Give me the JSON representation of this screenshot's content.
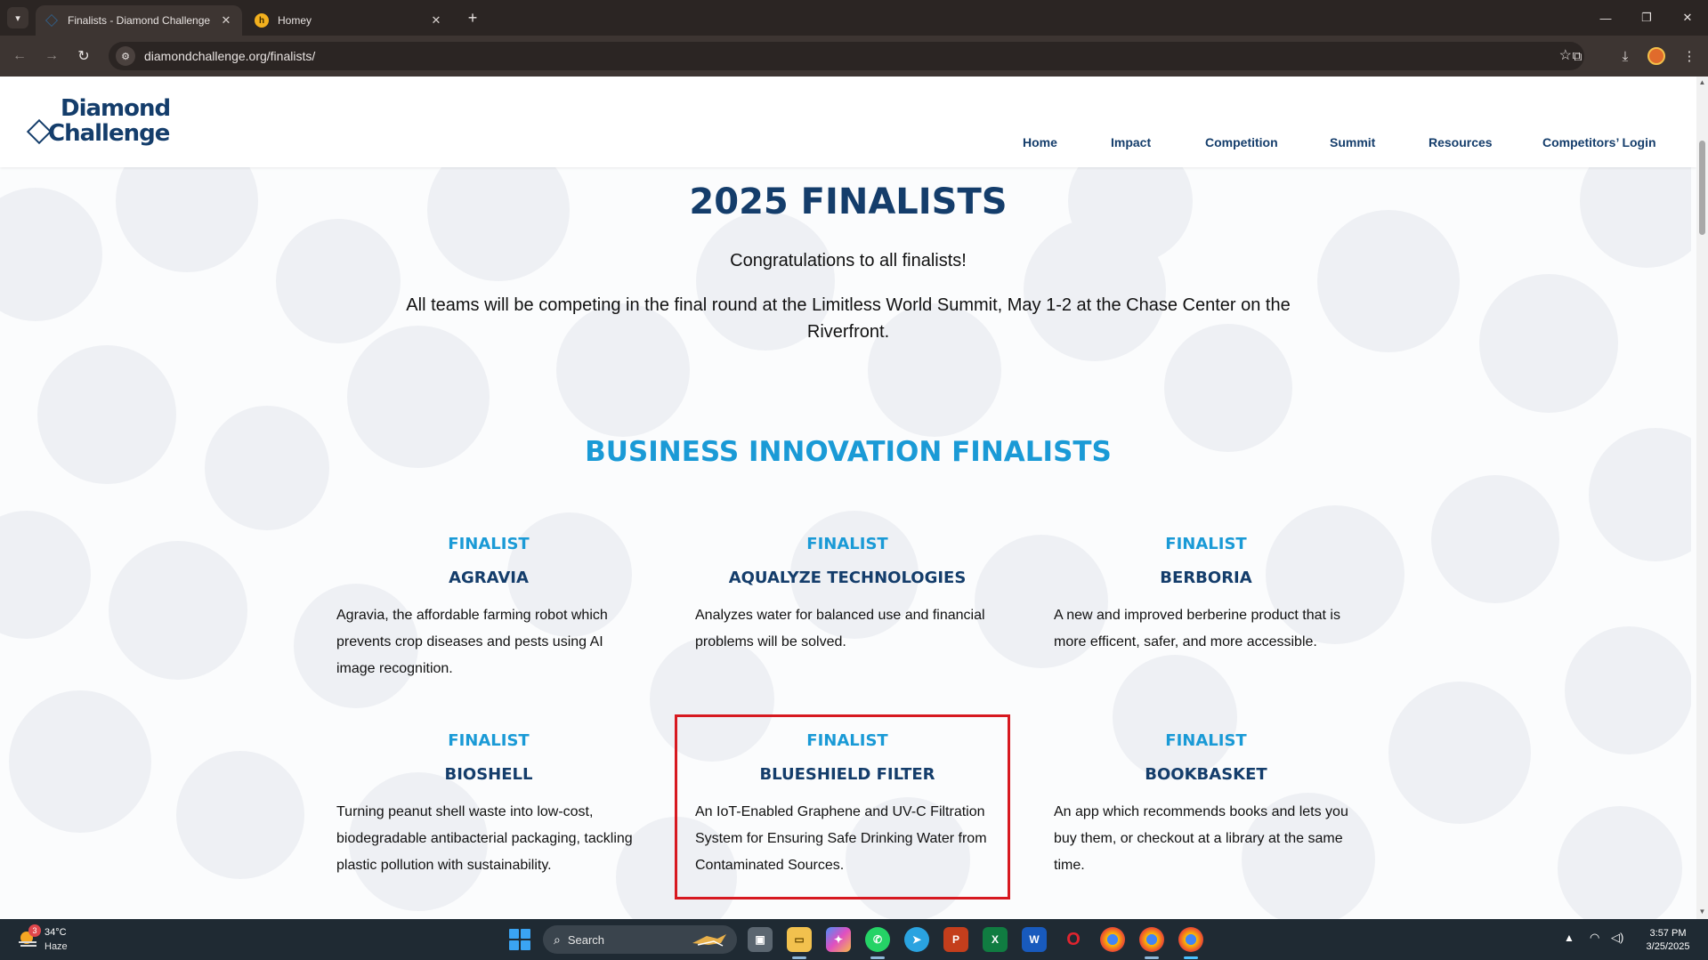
{
  "browser": {
    "tabs": [
      {
        "title": "Finalists - Diamond Challenge",
        "active": true
      },
      {
        "title": "Homey",
        "active": false
      }
    ],
    "url": "diamondchallenge.org/finalists/"
  },
  "site": {
    "logo_line1": "Diamond",
    "logo_line2": "Challenge",
    "nav": [
      "Home",
      "Impact",
      "Competition",
      "Summit",
      "Resources",
      "Competitors’ Login"
    ]
  },
  "page": {
    "title": "2025 FINALISTS",
    "congrats": "Congratulations to all finalists!",
    "intro": "All teams will be competing in the final round at the Limitless World Summit, May 1-2 at the Chase Center on the Riverfront.",
    "section_title": "BUSINESS INNOVATION FINALISTS",
    "finalists": [
      {
        "label": "FINALIST",
        "name": "AGRAVIA",
        "description": "Agravia, the affordable farming robot which prevents crop diseases and pests using AI image recognition."
      },
      {
        "label": "FINALIST",
        "name": "AQUALYZE TECHNOLOGIES",
        "description": "Analyzes water for balanced use and financial problems will be solved."
      },
      {
        "label": "FINALIST",
        "name": "BERBORIA",
        "description": "A new and improved berberine product that is more efficent, safer, and more accessible."
      },
      {
        "label": "FINALIST",
        "name": "BIOSHELL",
        "description": "Turning peanut shell waste into low-cost, biodegradable antibacterial packaging, tackling plastic pollution with sustainability."
      },
      {
        "label": "FINALIST",
        "name": "BLUESHIELD FILTER",
        "description": "An IoT-Enabled Graphene and UV-C Filtration System for Ensuring Safe Drinking Water from Contaminated Sources."
      },
      {
        "label": "FINALIST",
        "name": "BOOKBASKET",
        "description": "An app which recommends books and lets you buy them, or checkout at a library at the same time."
      }
    ]
  },
  "taskbar": {
    "weather_temp": "34°C",
    "weather_condition": "Haze",
    "weather_badge": "3",
    "search_placeholder": "Search",
    "time": "3:57 PM",
    "date": "3/25/2025"
  },
  "colors": {
    "brand_navy": "#143d6b",
    "accent_blue": "#1a9ad6",
    "highlight_red": "#d71920"
  }
}
